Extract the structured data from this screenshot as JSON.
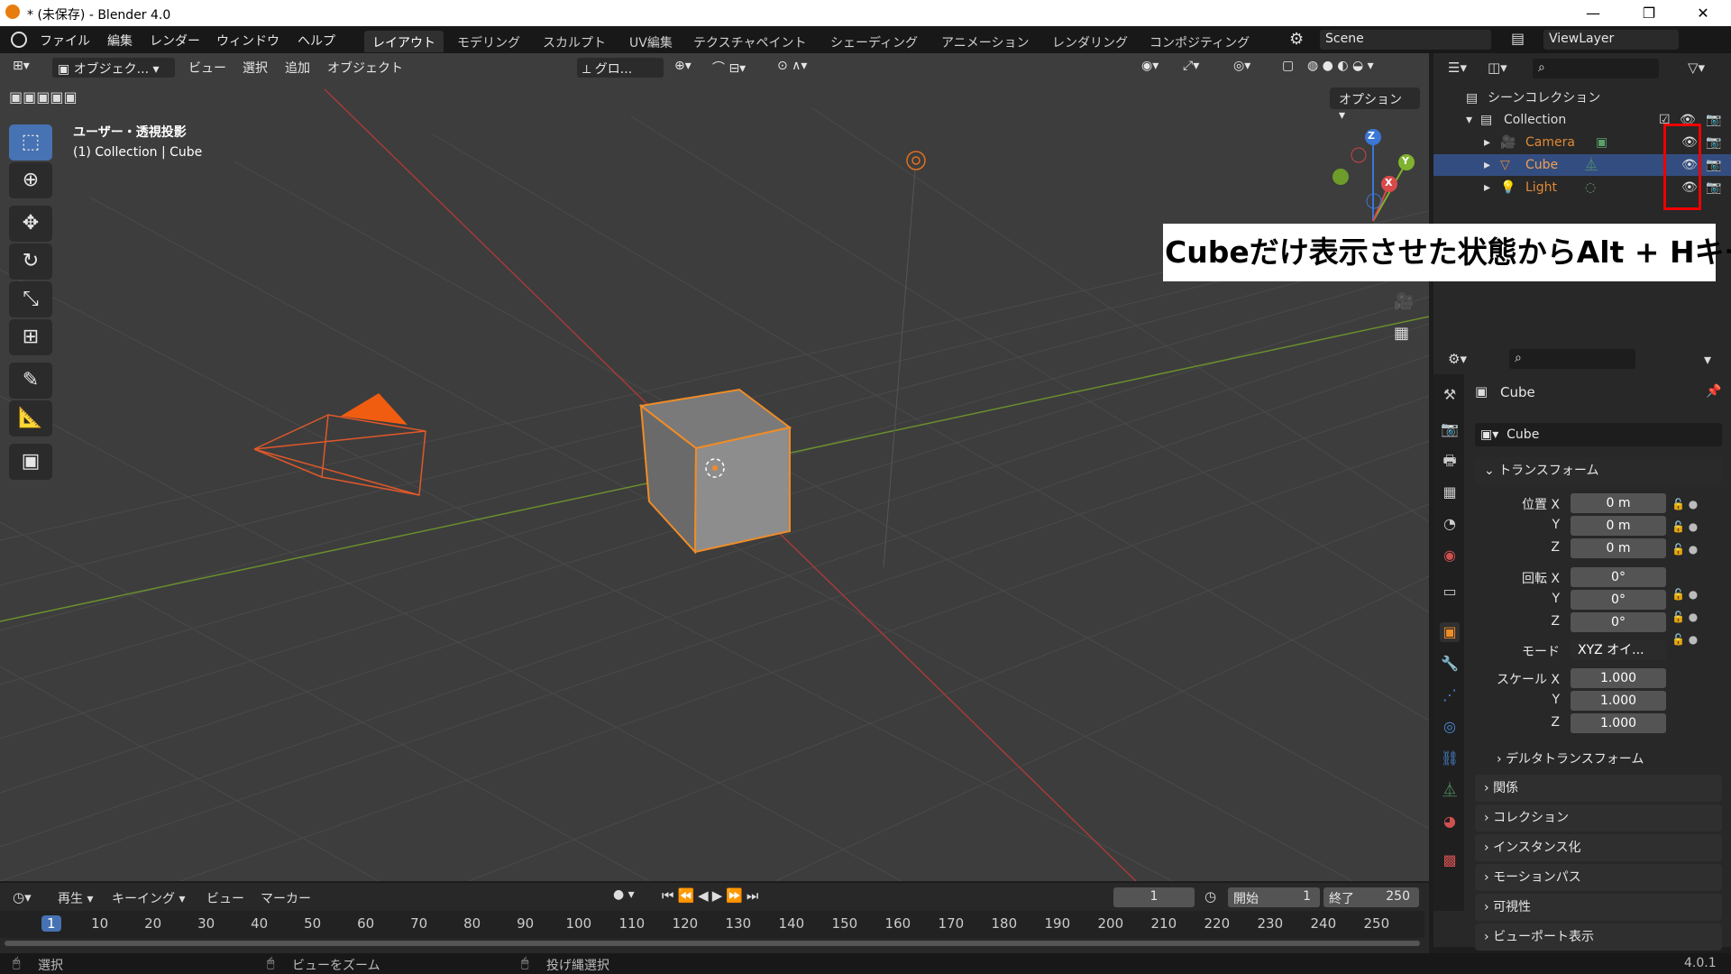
{
  "window": {
    "title": "* (未保存) - Blender 4.0",
    "min": "—",
    "max": "❐",
    "close": "✕"
  },
  "topbar": {
    "menus": [
      "ファイル",
      "編集",
      "レンダー",
      "ウィンドウ",
      "ヘルプ"
    ],
    "workspaces": [
      "レイアウト",
      "モデリング",
      "スカルプト",
      "UV編集",
      "テクスチャペイント",
      "シェーディング",
      "アニメーション",
      "レンダリング",
      "コンポジティング"
    ],
    "active_workspace": "レイアウト",
    "scene": "Scene",
    "view_layer": "ViewLayer"
  },
  "viewport": {
    "mode": "オブジェク...",
    "menus": [
      "ビュー",
      "選択",
      "追加",
      "オブジェクト"
    ],
    "transform_orientation": "グロ...",
    "options": "オプション",
    "view_name": "ユーザー・透視投影",
    "context": "(1) Collection | Cube",
    "callout": "Cubeだけ表示させた状態からAlt + Hキー",
    "gizmo": {
      "x": "X",
      "y": "Y",
      "z": "Z"
    }
  },
  "outliner": {
    "scene_collection": "シーンコレクション",
    "collection": "Collection",
    "objects": [
      {
        "name": "Camera",
        "color": "#e08a37"
      },
      {
        "name": "Cube",
        "color": "#e08a37"
      },
      {
        "name": "Light",
        "color": "#e08a37"
      }
    ]
  },
  "properties": {
    "object_name": "Cube",
    "data_name": "Cube",
    "transform_title": "トランスフォーム",
    "location_label": "位置 X",
    "rotation_label": "回転 X",
    "scale_label": "スケール X",
    "y": "Y",
    "z": "Z",
    "location": [
      "0 m",
      "0 m",
      "0 m"
    ],
    "rotation": [
      "0°",
      "0°",
      "0°"
    ],
    "mode_label": "モード",
    "mode_value": "XYZ オイ...",
    "scale": [
      "1.000",
      "1.000",
      "1.000"
    ],
    "delta": "デルタトランスフォーム",
    "panels": [
      "関係",
      "コレクション",
      "インスタンス化",
      "モーションパス",
      "可視性",
      "ビューポート表示"
    ]
  },
  "timeline": {
    "menus": [
      "再生",
      "キーイング",
      "ビュー",
      "マーカー"
    ],
    "current_frame": "1",
    "start_label": "開始",
    "start": "1",
    "end_label": "終了",
    "end": "250",
    "ticks": [
      "1",
      "10",
      "20",
      "30",
      "40",
      "50",
      "60",
      "70",
      "80",
      "90",
      "100",
      "110",
      "120",
      "130",
      "140",
      "150",
      "160",
      "170",
      "180",
      "190",
      "200",
      "210",
      "220",
      "230",
      "240",
      "250"
    ]
  },
  "statusbar": {
    "items": [
      "選択",
      "ビューをズーム",
      "投げ縄選択"
    ],
    "version": "4.0.1"
  },
  "colors": {
    "accent": "#4772b3",
    "selected": "#e08a37",
    "highlight_box": "#e00000"
  }
}
